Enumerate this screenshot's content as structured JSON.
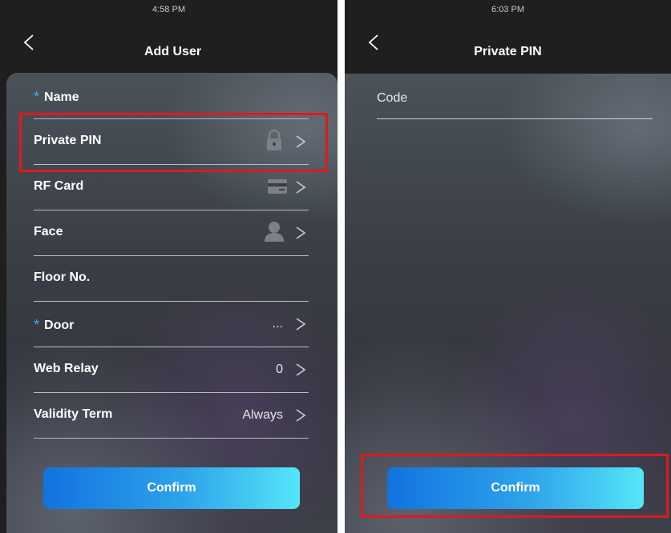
{
  "left_screen": {
    "status_time": "4:58 PM",
    "title": "Add User",
    "rows": [
      {
        "label": "Name",
        "required": "*",
        "value": ""
      },
      {
        "label": "Private PIN",
        "value": "",
        "icon": "lock-icon"
      },
      {
        "label": "RF Card",
        "value": "",
        "icon": "card-icon"
      },
      {
        "label": "Face",
        "value": "",
        "icon": "person-icon"
      },
      {
        "label": "Floor No.",
        "value": ""
      },
      {
        "label": "Door",
        "required": "*",
        "value": "..."
      },
      {
        "label": "Web Relay",
        "value": "0"
      },
      {
        "label": "Validity Term",
        "value": "Always"
      }
    ],
    "confirm_label": "Confirm"
  },
  "right_screen": {
    "status_time": "6:03 PM",
    "title": "Private PIN",
    "field_label": "Code",
    "confirm_label": "Confirm"
  },
  "colors": {
    "accent_blue": "#3fa9f5",
    "highlight_red": "#e0191b",
    "button_gradient_start": "#1273e0",
    "button_gradient_end": "#55e6f8"
  }
}
